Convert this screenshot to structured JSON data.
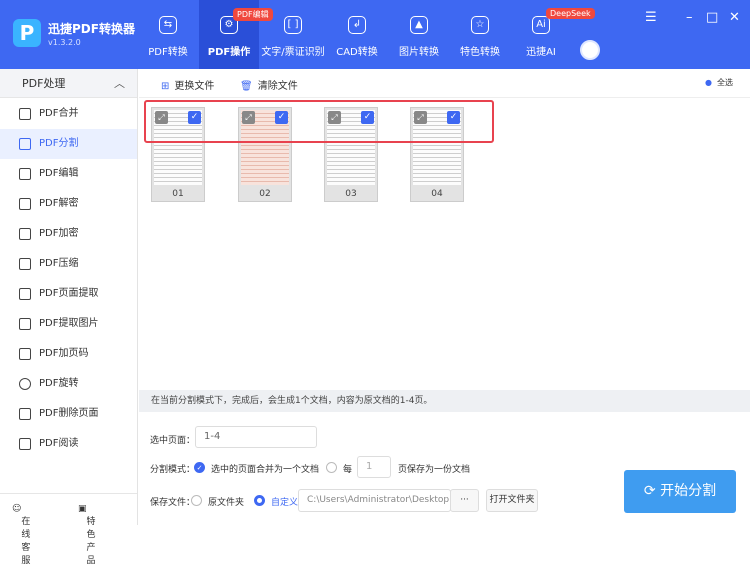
{
  "app": {
    "name": "迅捷PDF转换器",
    "version": "v1.3.2.0"
  },
  "tabs": [
    {
      "label": "PDF转换",
      "icon": "convert-icon"
    },
    {
      "label": "PDF操作",
      "icon": "gear-icon",
      "active": true,
      "badge": "PDF编辑"
    },
    {
      "label": "文字/票证识别",
      "icon": "scan-icon"
    },
    {
      "label": "CAD转换",
      "icon": "cad-icon"
    },
    {
      "label": "图片转换",
      "icon": "image-icon"
    },
    {
      "label": "特色转换",
      "icon": "star-icon"
    },
    {
      "label": "迅捷AI",
      "icon": "ai-icon",
      "badge": "DeepSeek"
    }
  ],
  "sidebar": {
    "title": "PDF处理",
    "items": [
      "PDF合并",
      "PDF分割",
      "PDF编辑",
      "PDF解密",
      "PDF加密",
      "PDF压缩",
      "PDF页面提取",
      "PDF提取图片",
      "PDF加页码",
      "PDF旋转",
      "PDF删除页面",
      "PDF阅读"
    ],
    "active": 1,
    "footer": [
      "在线客服",
      "特色产品"
    ]
  },
  "toolbar": {
    "replace": "更换文件",
    "clear": "清除文件",
    "select_all": "全选"
  },
  "pages": [
    "01",
    "02",
    "03",
    "04"
  ],
  "info": "在当前分割模式下，完成后，会生成1个文档，内容为原文档的1-4页。",
  "form": {
    "range_label": "选中页面：",
    "range_value": "1-4",
    "mode_label": "分割模式：",
    "mode_merge": "选中的页面合并为一个文档",
    "mode_every": "每",
    "every_value": "1",
    "every_suffix": "页保存为一份文档",
    "save_label": "保存文件：",
    "save_orig": "原文件夹",
    "save_custom": "自定义",
    "path": "C:\\Users\\Administrator\\Desktop",
    "browse": "···",
    "open_folder": "打开文件夹"
  },
  "start_button": "开始分割",
  "colors": {
    "brand": "#3e68f2",
    "start": "#3f9cf0",
    "highlight": "#e8434f"
  }
}
